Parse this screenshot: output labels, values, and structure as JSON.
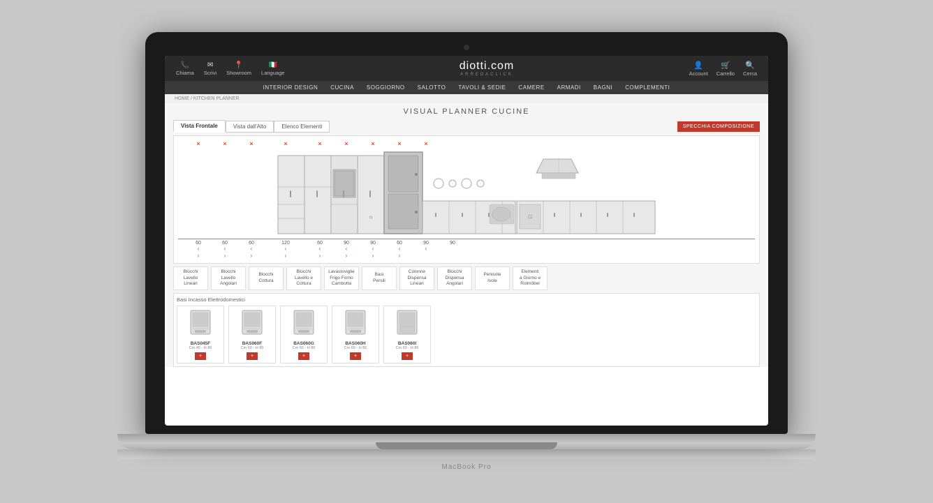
{
  "laptop": {
    "model": "MacBook Pro"
  },
  "site": {
    "topbar": {
      "left_items": [
        {
          "label": "Chiama",
          "icon": "📞"
        },
        {
          "label": "Scrivi",
          "icon": "✉"
        },
        {
          "label": "Showroom",
          "icon": "📍"
        },
        {
          "label": "Language",
          "icon": "🇮🇹"
        }
      ],
      "logo": "diotti.com",
      "logo_sub": "ARREDACLICK",
      "right_items": [
        {
          "label": "Account",
          "icon": "👤"
        },
        {
          "label": "Carrello",
          "icon": "🛒"
        },
        {
          "label": "Cerca",
          "icon": "🔍"
        }
      ]
    },
    "nav": {
      "items": [
        "INTERIOR DESIGN",
        "CUCINA",
        "SOGGIORNO",
        "SALOTTO",
        "TAVOLI & SEDIE",
        "CAMERE",
        "ARMADI",
        "BAGNI",
        "COMPLEMENTI"
      ]
    },
    "breadcrumb": "HOME / KITCHEN PLANNER",
    "page_title": "VISUAL PLANNER CUCINE",
    "planner": {
      "tabs": [
        "Vista Frontale",
        "Vista dall'Alto",
        "Elenco Elementi"
      ],
      "active_tab": 0,
      "specchia_btn": "SPECCHIA COMPOSIZIONE",
      "delete_marks": [
        "×",
        "×",
        "×",
        "×",
        "×",
        "×",
        "×",
        "×",
        "×"
      ],
      "measurements": [
        "60",
        "60",
        "60",
        "120",
        "60",
        "90",
        "90",
        "60",
        "90",
        "90"
      ],
      "arrows_up": [
        "‹",
        "‹",
        "‹",
        "‹",
        "‹",
        "‹",
        "‹",
        "‹",
        "‹"
      ],
      "arrows_down": [
        "›",
        "›",
        "›",
        "›",
        "›",
        "›",
        "›",
        "›"
      ]
    },
    "categories": [
      "Blocchi\nLavello\nLineari",
      "Blocchi\nLavello\nAngolari",
      "Blocchi\nCottura",
      "Blocchi\nLavello e\nCottura",
      "Lavastoviglie\nFrigo Forno\nCambotta",
      "Basi\nPersili",
      "Colonne\nDispensa\nLineari",
      "Blocchi\nDispensa\nAngolari",
      "Penisole\nIsole",
      "Elementi\na Giorno e\nRolmöbel"
    ],
    "products_section_title": "Basi Incasso Elettrodomestici",
    "products": [
      {
        "name": "BAS045F",
        "dim": "Cm 45 - H 86",
        "icon": "🖨"
      },
      {
        "name": "BAS060F",
        "dim": "Cm 60 - H 86",
        "icon": "🖨"
      },
      {
        "name": "BAS060G",
        "dim": "Cm 60 - H 86",
        "icon": "🖨"
      },
      {
        "name": "BAS060H",
        "dim": "Cm 60 - H 86",
        "icon": "🖨"
      },
      {
        "name": "BAS060I",
        "dim": "Cm 60 - H 86",
        "icon": "🖨"
      }
    ],
    "add_btn_label": "+"
  }
}
